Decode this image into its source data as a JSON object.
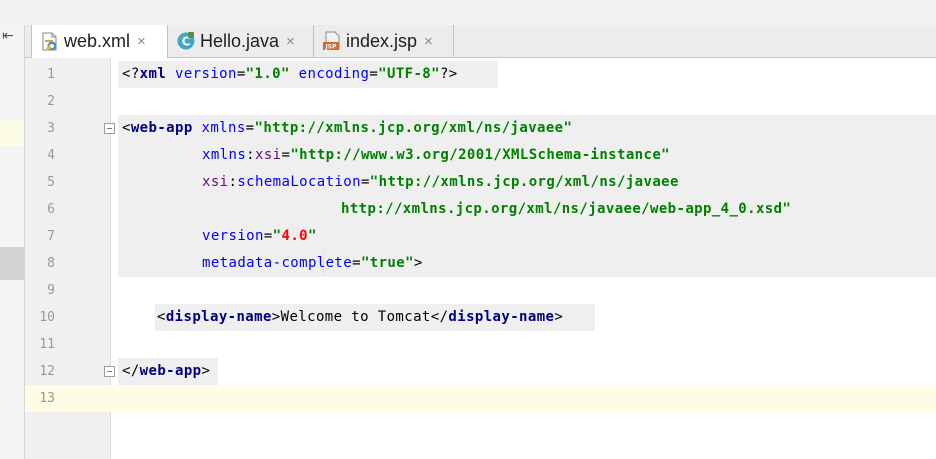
{
  "tabs": [
    {
      "label": "web.xml",
      "icon": "xml-file-icon",
      "active": true,
      "close": "×"
    },
    {
      "label": "Hello.java",
      "icon": "java-class-icon",
      "active": false,
      "close": "×"
    },
    {
      "label": "index.jsp",
      "icon": "jsp-file-icon",
      "active": false,
      "close": "×"
    }
  ],
  "icons": {
    "jsp_badge": "JSP",
    "class_badge": "C",
    "panel_arrow": "⇤"
  },
  "line_numbers": [
    "1",
    "2",
    "3",
    "4",
    "5",
    "6",
    "7",
    "8",
    "9",
    "10",
    "11",
    "12",
    "13"
  ],
  "code": {
    "l1": {
      "open": "<?",
      "tag": "xml",
      "a1": "version",
      "eq1": "=",
      "v1": "\"1.0\"",
      "a2": "encoding",
      "eq2": "=",
      "v2": "\"UTF-8\"",
      "close": "?>"
    },
    "l3": {
      "lt": "<",
      "tag": "web-app",
      "attr": "xmlns",
      "eq": "=",
      "val": "\"http://xmlns.jcp.org/xml/ns/javaee\""
    },
    "l4": {
      "ns": "xmlns",
      "colon": ":",
      "attr": "xsi",
      "eq": "=",
      "val": "\"http://www.w3.org/2001/XMLSchema-instance\""
    },
    "l5": {
      "ns": "xsi",
      "colon": ":",
      "attr": "schemaLocation",
      "eq": "=",
      "val": "\"http://xmlns.jcp.org/xml/ns/javaee"
    },
    "l6": {
      "val": "http://xmlns.jcp.org/xml/ns/javaee/web-app_4_0.xsd\""
    },
    "l7": {
      "attr": "version",
      "eq": "=",
      "q1": "\"",
      "num": "4.0",
      "q2": "\""
    },
    "l8": {
      "attr": "metadata-complete",
      "eq": "=",
      "val": "\"true\"",
      "gt": ">"
    },
    "l10": {
      "lt1": "<",
      "tag1": "display-name",
      "gt1": ">",
      "text": "Welcome to Tomcat",
      "lt2": "</",
      "tag2": "display-name",
      "gt2": ">"
    },
    "l12": {
      "lt": "</",
      "tag": "web-app",
      "gt": ">"
    }
  }
}
